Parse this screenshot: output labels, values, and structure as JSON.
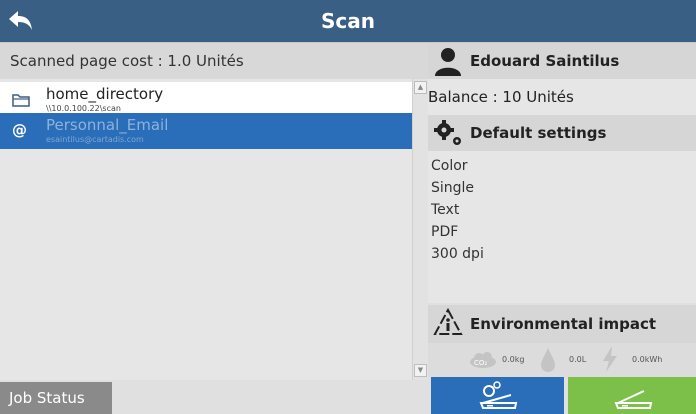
{
  "header": {
    "title": "Scan",
    "back_icon": "back-arrow-icon"
  },
  "left": {
    "cost_label": "Scanned page cost : 1.0 Unités",
    "destinations": [
      {
        "name": "home_directory",
        "path": "\\\\10.0.100.22\\scan",
        "icon": "folder-icon",
        "selected": false
      },
      {
        "name": "Personnal_Email",
        "path": "esaintilus@cartadis.com",
        "icon": "at-sign-icon",
        "selected": true
      }
    ],
    "job_status_label": "Job Status"
  },
  "user": {
    "name": "Edouard Saintilus",
    "balance": "Balance : 10 Unités"
  },
  "settings": {
    "header": "Default settings",
    "items": [
      "Color",
      "Single",
      "Text",
      "PDF",
      "300 dpi"
    ]
  },
  "environment": {
    "header": "Environmental impact",
    "co2": "0.0kg",
    "water": "0.0L",
    "energy": "0.0kWh"
  },
  "colors": {
    "header_bg": "#3a5f85",
    "selected_bg": "#2a6db8",
    "scan_green": "#7cc04a"
  }
}
